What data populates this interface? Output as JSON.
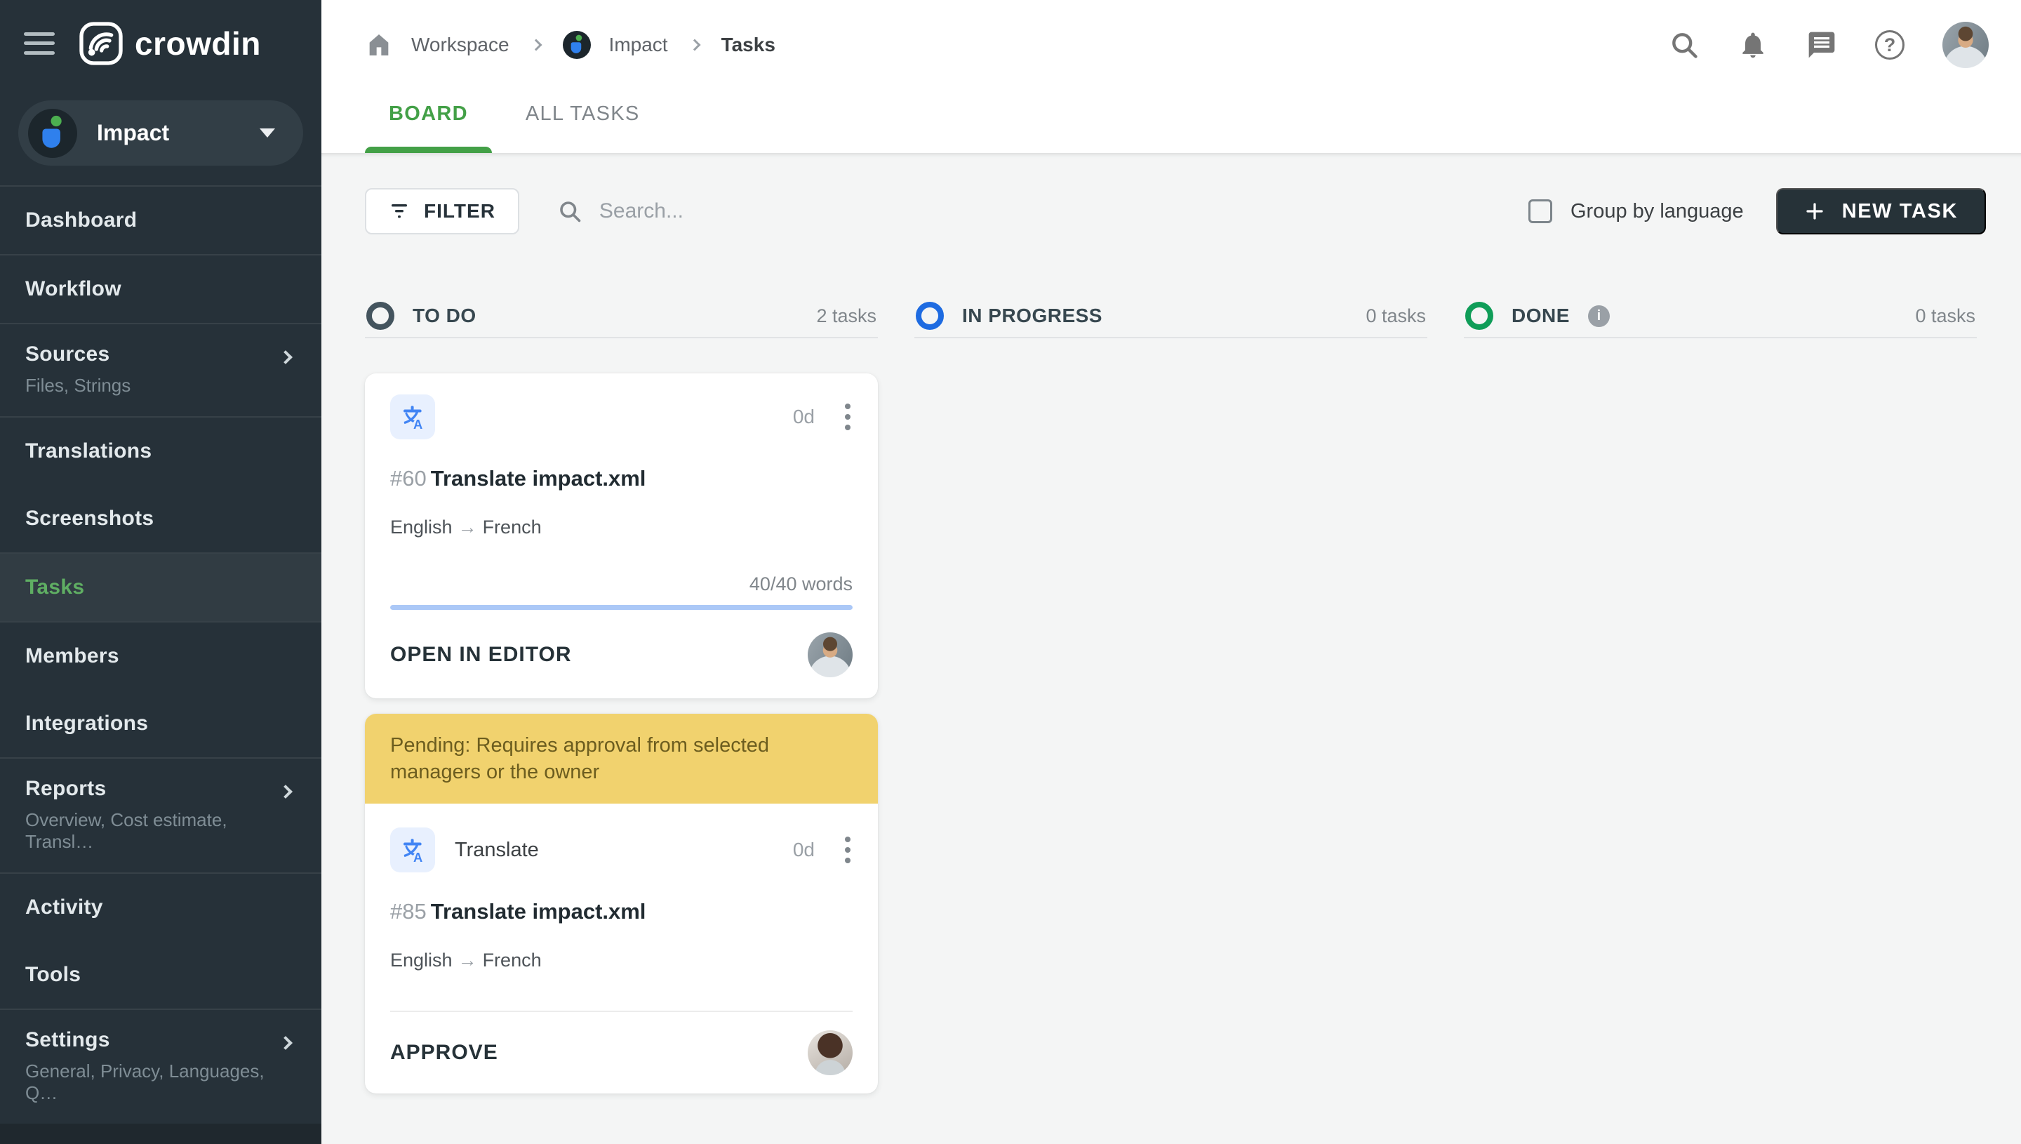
{
  "sidebar": {
    "logo_text": "crowdin",
    "project": {
      "name": "Impact"
    },
    "items": [
      {
        "label": "Dashboard"
      },
      {
        "label": "Workflow"
      },
      {
        "label": "Sources",
        "subtitle": "Files, Strings"
      },
      {
        "label": "Translations"
      },
      {
        "label": "Screenshots"
      },
      {
        "label": "Tasks"
      },
      {
        "label": "Members"
      },
      {
        "label": "Integrations"
      },
      {
        "label": "Reports",
        "subtitle": "Overview, Cost estimate, Transl…"
      },
      {
        "label": "Activity"
      },
      {
        "label": "Tools"
      },
      {
        "label": "Settings",
        "subtitle": "General, Privacy, Languages, Q…"
      }
    ]
  },
  "breadcrumb": {
    "workspace": "Workspace",
    "project": "Impact",
    "page": "Tasks"
  },
  "topbar_icons": {
    "help_glyph": "?"
  },
  "tabs": {
    "board": "BOARD",
    "all_tasks": "ALL TASKS"
  },
  "toolbar": {
    "filter_label": "FILTER",
    "search_placeholder": "Search...",
    "group_by_language_label": "Group by language",
    "new_task_label": "NEW TASK"
  },
  "columns": [
    {
      "name": "TO DO",
      "count": "2 tasks",
      "color": "#44545e"
    },
    {
      "name": "IN PROGRESS",
      "count": "0 tasks",
      "color": "#1e6be1"
    },
    {
      "name": "DONE",
      "count": "0 tasks",
      "color": "#0f9d58",
      "info_glyph": "i"
    }
  ],
  "cards": [
    {
      "id": "#60",
      "title": "Translate impact.xml",
      "duration": "0d",
      "languages": {
        "from": "English",
        "arrow": "→",
        "to": "French"
      },
      "words": "40/40 words",
      "progress_percent": 100,
      "action": "OPEN IN EDITOR"
    },
    {
      "banner": "Pending: Requires approval from selected managers or the owner",
      "type_label": "Translate",
      "id": "#85",
      "title": "Translate impact.xml",
      "duration": "0d",
      "languages": {
        "from": "English",
        "arrow": "→",
        "to": "French"
      },
      "action": "APPROVE"
    }
  ],
  "colors": {
    "sidebar_bg": "#263139",
    "accent_green": "#43a047",
    "sidebar_active_green": "#5fae63",
    "todo_ring": "#44545e",
    "in_progress_ring": "#1e6be1",
    "done_ring": "#0f9d58",
    "banner_bg": "#f1d26e",
    "progress_bar": "#abc8f7",
    "new_task_bg": "#263238"
  }
}
